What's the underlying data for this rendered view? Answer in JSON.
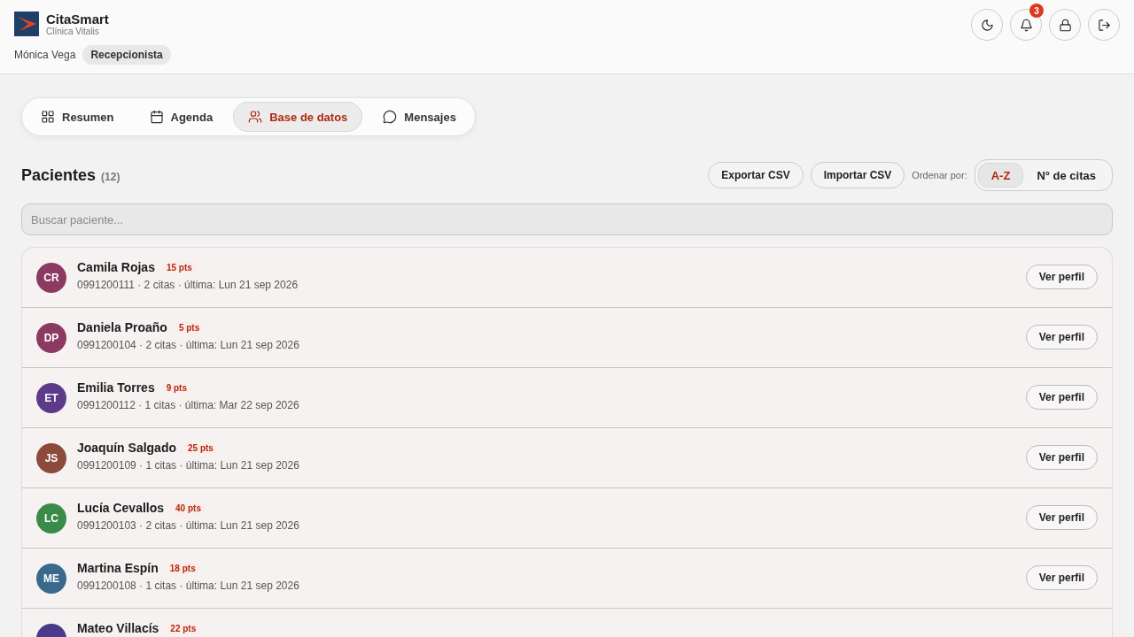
{
  "brand": {
    "name": "CitaSmart",
    "clinic": "Clínica Vitalis"
  },
  "user": {
    "name": "Mónica Vega",
    "role": "Recepcionista"
  },
  "header_actions": [
    {
      "kind": "theme"
    },
    {
      "kind": "bell",
      "badge": "3"
    },
    {
      "kind": "lock"
    },
    {
      "kind": "logout"
    }
  ],
  "tabs": [
    {
      "label": "Resumen",
      "kind": "grid",
      "selected": false
    },
    {
      "label": "Agenda",
      "kind": "calendar",
      "selected": false
    },
    {
      "label": "Base de datos",
      "kind": "users",
      "selected": true
    },
    {
      "label": "Mensajes",
      "kind": "chat",
      "selected": false
    }
  ],
  "section": {
    "title": "Pacientes",
    "count": "(12)"
  },
  "actions": [
    "Exportar CSV",
    "Importar CSV"
  ],
  "sort": {
    "label": "Ordenar por:",
    "options": [
      {
        "label": "A-Z",
        "selected": true
      },
      {
        "label": "N° de citas",
        "selected": false
      }
    ]
  },
  "search": {
    "placeholder": "Buscar paciente..."
  },
  "patients": [
    {
      "initials": "CR",
      "color": "#8b3a62",
      "name": "Camila Rojas",
      "points": "15 pts",
      "meta": "0991200111 · 2 citas · última: Lun 21 sep 2026",
      "button": "Ver perfil"
    },
    {
      "initials": "DP",
      "color": "#8b3a62",
      "name": "Daniela Proaño",
      "points": "5 pts",
      "meta": "0991200104 · 2 citas · última: Lun 21 sep 2026",
      "button": "Ver perfil"
    },
    {
      "initials": "ET",
      "color": "#5e3a8b",
      "name": "Emilia Torres",
      "points": "9 pts",
      "meta": "0991200112 · 1 citas · última: Mar 22 sep 2026",
      "button": "Ver perfil"
    },
    {
      "initials": "JS",
      "color": "#8b4a3a",
      "name": "Joaquín Salgado",
      "points": "25 pts",
      "meta": "0991200109 · 1 citas · última: Lun 21 sep 2026",
      "button": "Ver perfil"
    },
    {
      "initials": "LC",
      "color": "#3a8b4a",
      "name": "Lucía Cevallos",
      "points": "40 pts",
      "meta": "0991200103 · 2 citas · última: Lun 21 sep 2026",
      "button": "Ver perfil"
    },
    {
      "initials": "ME",
      "color": "#3a6a8b",
      "name": "Martina Espín",
      "points": "18 pts",
      "meta": "0991200108 · 1 citas · última: Lun 21 sep 2026",
      "button": "Ver perfil"
    },
    {
      "color": "#4a3a8b",
      "name": "Mateo Villacís",
      "points": "22 pts"
    }
  ]
}
